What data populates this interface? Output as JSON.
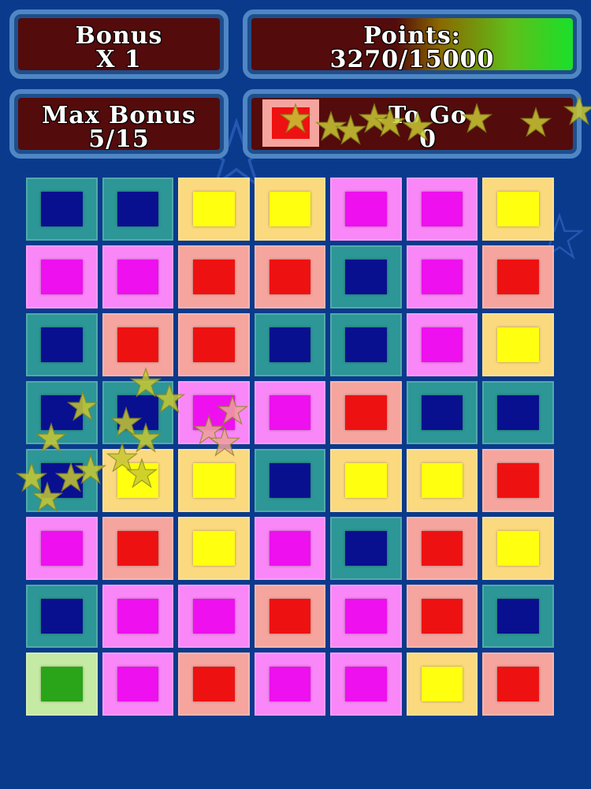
{
  "hud": {
    "bonus_label": "Bonus",
    "bonus_value": "X 1",
    "points_label": "Points:",
    "points_value": "3270/15000",
    "points_progress": 0.218,
    "max_bonus_label": "Max Bonus",
    "max_bonus_value": "5/15",
    "togo_label": "To Go",
    "togo_value": "0",
    "togo_tile_color": "red"
  },
  "colors": {
    "background": "#0a3a8c",
    "blue": {
      "outer": "#2d9696",
      "inner": "#08108f"
    },
    "magenta": {
      "outer": "#fa87f7",
      "inner": "#ee10ee"
    },
    "yellow": {
      "outer": "#fbd97f",
      "inner": "#ffff10"
    },
    "red": {
      "outer": "#f6a59e",
      "inner": "#ee1111"
    },
    "green": {
      "outer": "#c5eaa4",
      "inner": "#2aa418"
    }
  },
  "board": {
    "rows": [
      [
        "blue",
        "blue",
        "yellow",
        "yellow",
        "magenta",
        "magenta",
        "yellow"
      ],
      [
        "magenta",
        "magenta",
        "red",
        "red",
        "blue",
        "magenta",
        "red"
      ],
      [
        "blue",
        "red",
        "red",
        "blue",
        "blue",
        "magenta",
        "yellow"
      ],
      [
        "blue",
        "blue",
        "magenta",
        "magenta",
        "red",
        "blue",
        "blue"
      ],
      [
        "blue",
        "yellow",
        "yellow",
        "blue",
        "yellow",
        "yellow",
        "red"
      ],
      [
        "magenta",
        "red",
        "yellow",
        "magenta",
        "blue",
        "red",
        "yellow"
      ],
      [
        "blue",
        "magenta",
        "magenta",
        "red",
        "magenta",
        "red",
        "blue"
      ],
      [
        "green",
        "magenta",
        "red",
        "magenta",
        "magenta",
        "yellow",
        "red"
      ]
    ]
  },
  "effects": {
    "sparkle_star_icon": "star-icon",
    "sparkle_color": "#c8c832"
  }
}
